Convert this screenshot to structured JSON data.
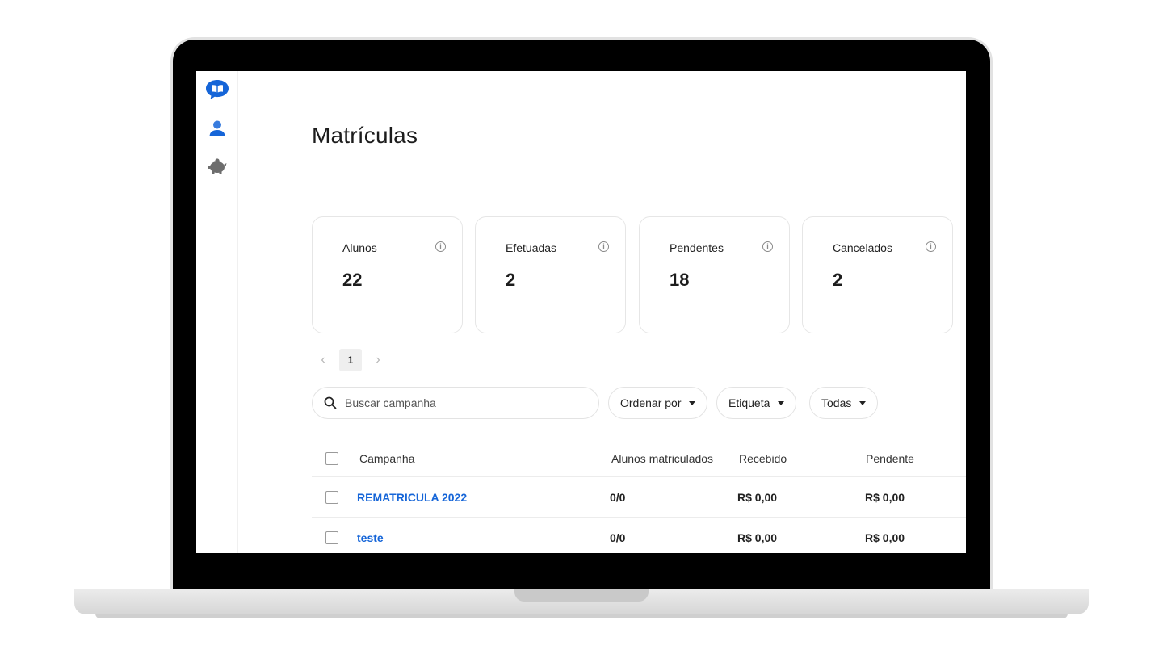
{
  "page": {
    "title": "Matrículas"
  },
  "sidebar": {
    "items": [
      {
        "name": "logo-icon"
      },
      {
        "name": "user-icon"
      },
      {
        "name": "piggy-bank-icon"
      }
    ]
  },
  "stats": [
    {
      "label": "Alunos",
      "value": "22"
    },
    {
      "label": "Efetuadas",
      "value": "2"
    },
    {
      "label": "Pendentes",
      "value": "18"
    },
    {
      "label": "Cancelados",
      "value": "2"
    }
  ],
  "pagination": {
    "prev": "‹",
    "current": "1",
    "next": "›"
  },
  "filters": {
    "search_placeholder": "Buscar campanha",
    "order_by": "Ordenar por",
    "tag": "Etiqueta",
    "status": "Todas"
  },
  "table": {
    "columns": [
      "Campanha",
      "Alunos matriculados",
      "Recebido",
      "Pendente"
    ],
    "rows": [
      {
        "campaign": "REMATRICULA 2022",
        "enrolled": "0/0",
        "received": "R$ 0,00",
        "pending": "R$ 0,00"
      },
      {
        "campaign": "teste",
        "enrolled": "0/0",
        "received": "R$ 0,00",
        "pending": "R$ 0,00"
      }
    ]
  },
  "colors": {
    "accent": "#1565d8",
    "link": "#1565d8"
  }
}
